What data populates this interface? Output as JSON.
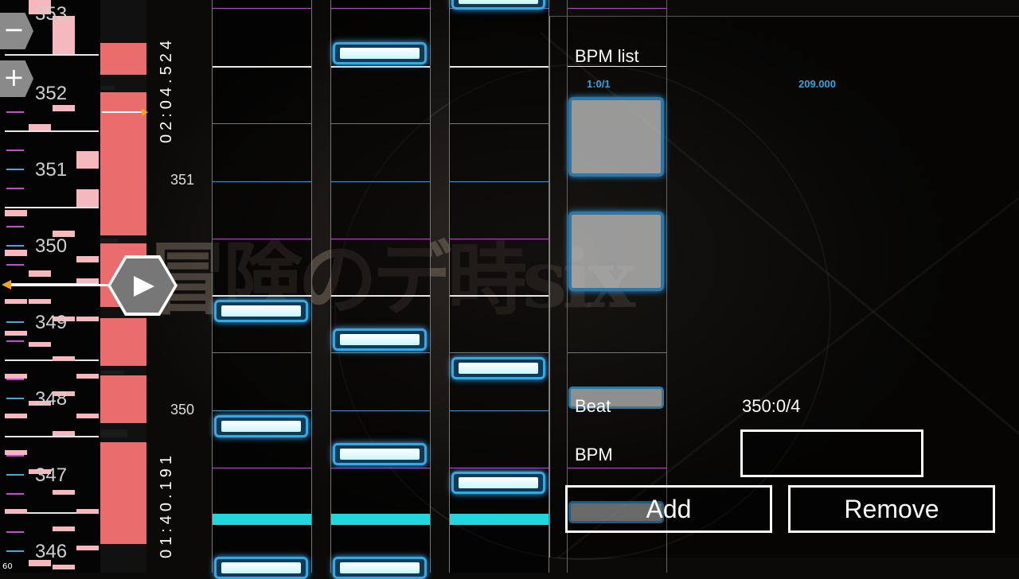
{
  "background": {
    "title_art": "冒険のデ時six"
  },
  "measure_panel": {
    "zoom_out_label": "−",
    "zoom_in_label": "+",
    "measures": [
      "353",
      "352",
      "351",
      "350",
      "349",
      "348",
      "347",
      "346"
    ],
    "corner_value": "60"
  },
  "timeline": {
    "time_top": "02:04.524",
    "time_bottom": "01:40.191",
    "lane_measure_top": "351",
    "lane_measure_bottom": "350"
  },
  "bpm_panel": {
    "title": "BPM list",
    "entries": [
      {
        "position": "1:0/1",
        "bpm": "209.000"
      }
    ],
    "beat_label": "Beat",
    "beat_value": "350:0/4",
    "bpm_label": "BPM",
    "bpm_input_value": "",
    "add_label": "Add",
    "remove_label": "Remove"
  },
  "colors": {
    "note_border": "#3aa8e0",
    "judge_line": "#1fd7dd",
    "density": "#e96d6d",
    "accent_text": "#2fa4e0"
  }
}
